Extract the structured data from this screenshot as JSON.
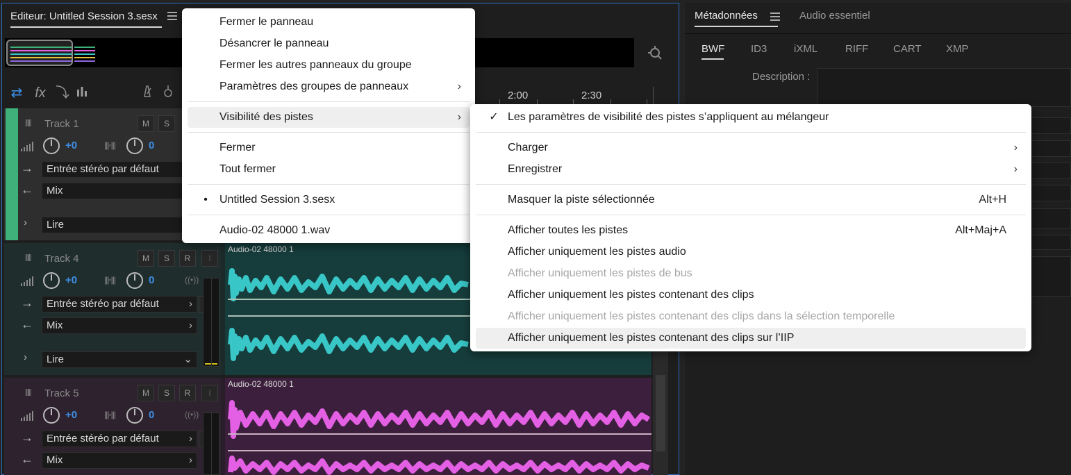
{
  "editor": {
    "tab_title": "Editeur: Untitled Session 3.sesx",
    "ruler_labels": [
      "2:00",
      "2:30"
    ]
  },
  "tracks": [
    {
      "name": "Track 1",
      "color": "#3fb07a",
      "volume": "+0",
      "pan": "0",
      "input": "Entrée stéréo par défaut",
      "output": "Mix",
      "automation": "Lire",
      "buttons": [
        "M",
        "S"
      ]
    },
    {
      "name": "Track 4",
      "color": "#1f4f4a",
      "volume": "+0",
      "pan": "0",
      "input": "Entrée stéréo par défaut",
      "output": "Mix",
      "automation": "Lire",
      "buttons": [
        "M",
        "S",
        "R",
        "I"
      ],
      "clip_name": "Audio-02 48000 1",
      "clip_color": "#39c6c6"
    },
    {
      "name": "Track 5",
      "color": "#4a2a4a",
      "volume": "+0",
      "pan": "0",
      "input": "Entrée stéréo par défaut",
      "output": "Mix",
      "buttons": [
        "M",
        "S",
        "R",
        "I"
      ],
      "clip_name": "Audio-02 48000 1",
      "clip_color": "#e35fe3"
    }
  ],
  "meta_panel": {
    "tabs": [
      "Métadonnées",
      "Audio essentiel"
    ],
    "subtabs": [
      "BWF",
      "ID3",
      "iXML",
      "RIFF",
      "CART",
      "XMP"
    ],
    "description_label": "Description :"
  },
  "panel_menu": {
    "items": [
      {
        "label": "Fermer le panneau"
      },
      {
        "label": "Désancrer le panneau"
      },
      {
        "label": "Fermer les autres panneaux du groupe"
      },
      {
        "label": "Paramètres des groupes de panneaux",
        "submenu": true
      },
      {
        "label": "Visibilité des pistes",
        "submenu": true,
        "hover": true
      },
      {
        "label": "Fermer"
      },
      {
        "label": "Tout fermer"
      },
      {
        "label": "Untitled Session 3.sesx",
        "bullet": true
      },
      {
        "label": "Audio-02 48000 1.wav"
      }
    ]
  },
  "visibility_menu": {
    "items": [
      {
        "label": "Les paramètres de visibilité des pistes s’appliquent au mélangeur",
        "checked": true
      },
      {
        "label": "Charger",
        "submenu": true
      },
      {
        "label": "Enregistrer",
        "submenu": true
      },
      {
        "label": "Masquer la piste sélectionnée",
        "shortcut": "Alt+H"
      },
      {
        "label": "Afficher toutes les pistes",
        "shortcut": "Alt+Maj+A"
      },
      {
        "label": "Afficher uniquement les pistes audio"
      },
      {
        "label": "Afficher uniquement les pistes de bus",
        "disabled": true
      },
      {
        "label": "Afficher uniquement les pistes contenant des clips"
      },
      {
        "label": "Afficher uniquement les pistes contenant des clips dans la sélection temporelle",
        "disabled": true
      },
      {
        "label": "Afficher uniquement les pistes contenant des clips sur l’IIP",
        "hover": true
      }
    ]
  },
  "icons": {
    "check": "✓",
    "bullet": "•",
    "chevron": "›"
  }
}
